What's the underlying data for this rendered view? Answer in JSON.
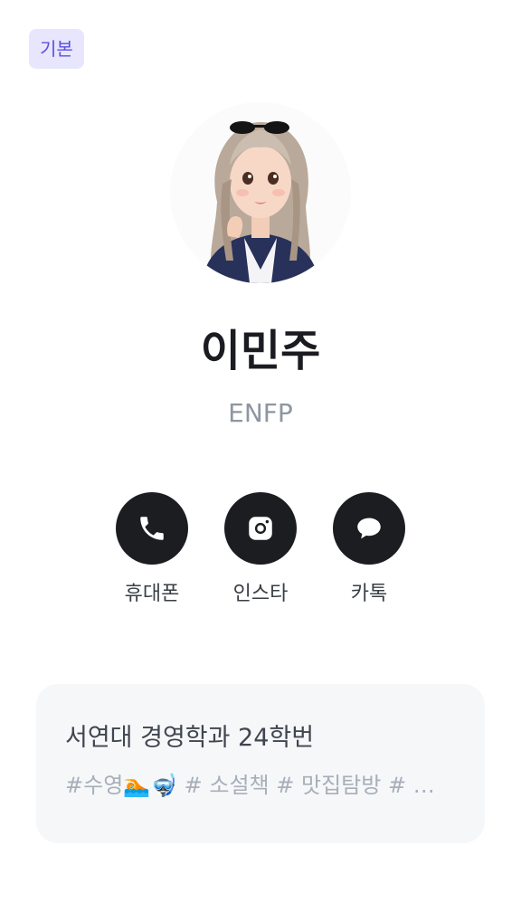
{
  "badge": {
    "label": "기본"
  },
  "profile": {
    "name": "이민주",
    "mbti": "ENFP"
  },
  "actions": [
    {
      "label": "휴대폰",
      "icon": "phone-icon"
    },
    {
      "label": "인스타",
      "icon": "instagram-icon"
    },
    {
      "label": "카톡",
      "icon": "chat-bubble-icon"
    }
  ],
  "card": {
    "title": "서연대 경영학과 24학번",
    "tags": "#수영🏊🤿 # 소설책 # 맛집탐방 # 냥..."
  },
  "colors": {
    "badge_bg": "#e7e6fd",
    "badge_text": "#5b4fe0",
    "action_bg": "#1b1d21",
    "card_bg": "#f6f7f9",
    "muted_text": "#8e96a1"
  }
}
